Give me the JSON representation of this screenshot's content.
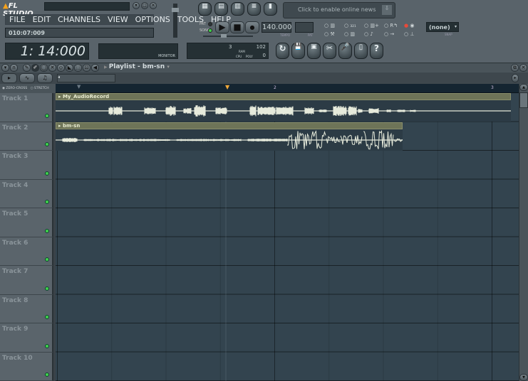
{
  "app": {
    "logo": "FL STUDIO",
    "menu": [
      "FILE",
      "EDIT",
      "CHANNELS",
      "VIEW",
      "OPTIONS",
      "TOOLS",
      "HELP"
    ],
    "hint": "010:07:009",
    "time": "1: 14:000",
    "monitor_label": "MONITOR"
  },
  "news": {
    "text": "Click to enable online news"
  },
  "transport": {
    "pat_label": "PAT",
    "song_label": "SONG",
    "tempo_display": "140.000",
    "tempo_label": "TEMPO",
    "pat_display_label": "PAT",
    "snap_value": "(none)",
    "snap_label": "SNAP"
  },
  "meters": {
    "voices": "3",
    "ram": "102",
    "ram_label": "RAM",
    "cpu_label": "CPU",
    "poly_label": "POLY",
    "poly": "0"
  },
  "playlist": {
    "title": "Playlist - bm-sn",
    "zero_cross": "ZERO-CROSS",
    "stretch": "STRETCH",
    "ruler": [
      "2",
      "3"
    ],
    "clips": [
      {
        "name": "My_AudioRecord"
      },
      {
        "name": "bm-sn"
      }
    ],
    "tracks": [
      "Track 1",
      "Track 2",
      "Track 3",
      "Track 4",
      "Track 5",
      "Track 6",
      "Track 7",
      "Track 8",
      "Track 9",
      "Track 10"
    ]
  },
  "colors": {
    "grid": "#33444f",
    "clip": "#6e7458",
    "wave": "#e6eadb",
    "led_green": "#3fd24a",
    "record": "#e84a3a"
  }
}
